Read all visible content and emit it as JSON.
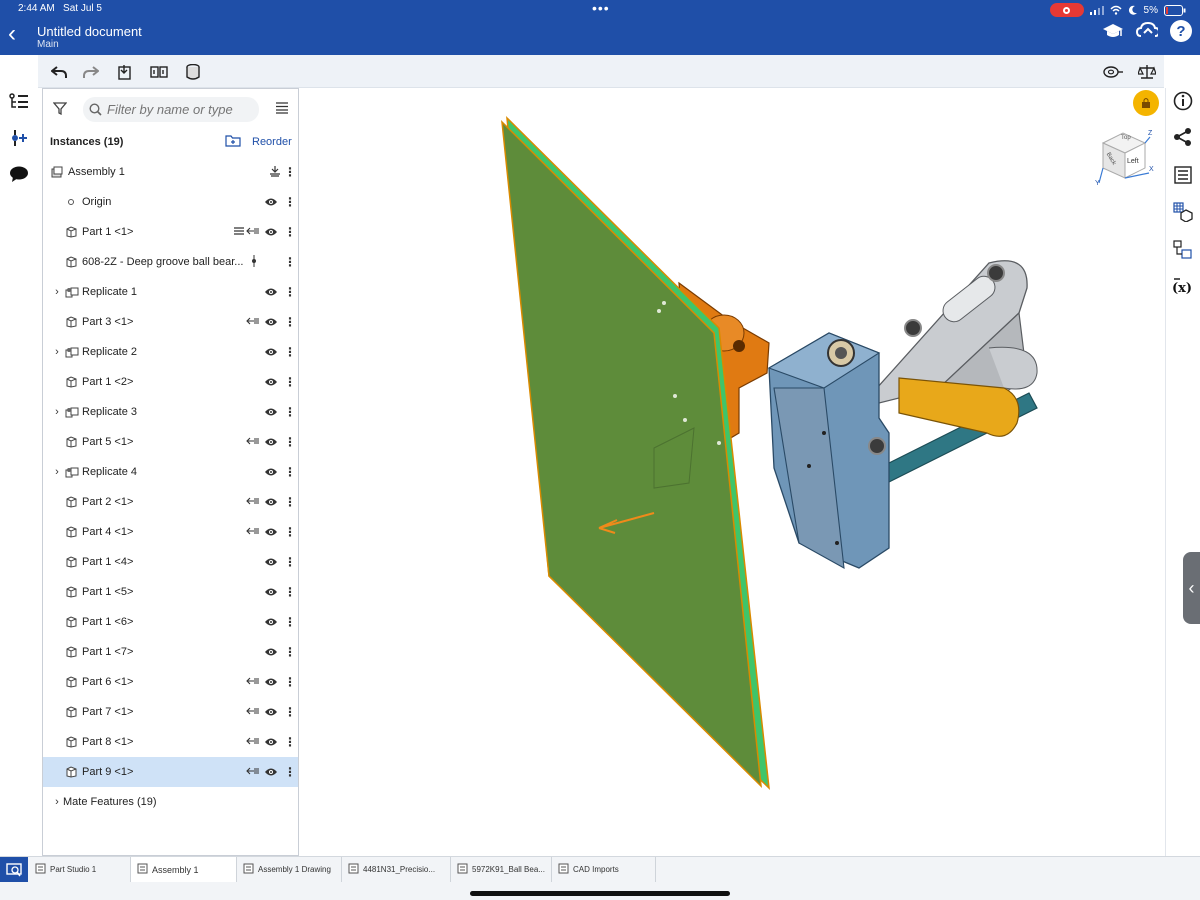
{
  "status_bar": {
    "time": "2:44 AM",
    "date": "Sat Jul 5",
    "battery": "5%"
  },
  "header": {
    "title": "Untitled document",
    "subtitle": "Main"
  },
  "panel": {
    "search_placeholder": "Filter by name or type",
    "instances_label": "Instances (19)",
    "reorder_label": "Reorder",
    "rows": [
      {
        "label": "Assembly 1",
        "type": "assembly",
        "expandable": false,
        "mate": false,
        "eye": false,
        "special": "fix"
      },
      {
        "label": "Origin",
        "type": "origin",
        "expandable": false,
        "mate": false,
        "eye": true
      },
      {
        "label": "Part 1 <1>",
        "type": "part",
        "expandable": false,
        "mate": true,
        "eye": true,
        "special": "fixed"
      },
      {
        "label": "608-2Z - Deep groove ball bear...",
        "type": "part",
        "expandable": false,
        "mate": false,
        "eye": false,
        "special": "pin"
      },
      {
        "label": "Replicate 1",
        "type": "replicate",
        "expandable": true,
        "mate": false,
        "eye": true
      },
      {
        "label": "Part 3 <1>",
        "type": "part",
        "expandable": false,
        "mate": true,
        "eye": true
      },
      {
        "label": "Replicate 2",
        "type": "replicate",
        "expandable": true,
        "mate": false,
        "eye": true
      },
      {
        "label": "Part 1 <2>",
        "type": "part",
        "expandable": false,
        "mate": false,
        "eye": true
      },
      {
        "label": "Replicate 3",
        "type": "replicate",
        "expandable": true,
        "mate": false,
        "eye": true
      },
      {
        "label": "Part 5 <1>",
        "type": "part",
        "expandable": false,
        "mate": true,
        "eye": true
      },
      {
        "label": "Replicate 4",
        "type": "replicate",
        "expandable": true,
        "mate": false,
        "eye": true
      },
      {
        "label": "Part 2 <1>",
        "type": "part",
        "expandable": false,
        "mate": true,
        "eye": true
      },
      {
        "label": "Part 4 <1>",
        "type": "part",
        "expandable": false,
        "mate": true,
        "eye": true
      },
      {
        "label": "Part 1 <4>",
        "type": "part",
        "expandable": false,
        "mate": false,
        "eye": true
      },
      {
        "label": "Part 1 <5>",
        "type": "part",
        "expandable": false,
        "mate": false,
        "eye": true
      },
      {
        "label": "Part 1 <6>",
        "type": "part",
        "expandable": false,
        "mate": false,
        "eye": true
      },
      {
        "label": "Part 1 <7>",
        "type": "part",
        "expandable": false,
        "mate": false,
        "eye": true
      },
      {
        "label": "Part 6 <1>",
        "type": "part",
        "expandable": false,
        "mate": true,
        "eye": true
      },
      {
        "label": "Part 7 <1>",
        "type": "part",
        "expandable": false,
        "mate": true,
        "eye": true
      },
      {
        "label": "Part 8 <1>",
        "type": "part",
        "expandable": false,
        "mate": true,
        "eye": true
      },
      {
        "label": "Part 9 <1>",
        "type": "part",
        "expandable": false,
        "mate": true,
        "eye": true,
        "selected": true
      }
    ],
    "mate_features_label": "Mate Features (19)"
  },
  "viewcube": {
    "face_left": "Left",
    "face_back": "Back",
    "face_top": "Top",
    "axis_x": "X",
    "axis_y": "Y",
    "axis_z": "Z"
  },
  "tabs": [
    {
      "label": "Part Studio 1",
      "active": false
    },
    {
      "label": "Assembly 1",
      "active": true
    },
    {
      "label": "Assembly 1 Drawing",
      "active": false
    },
    {
      "label": "4481N31_Precisio...",
      "active": false
    },
    {
      "label": "5972K91_Ball Bea...",
      "active": false
    },
    {
      "label": "CAD Imports",
      "active": false
    }
  ],
  "colors": {
    "brand": "#1f4fa8",
    "selected_row": "#cfe2f7",
    "plate": "#5e8c3a",
    "plate_edge": "#3fc56a",
    "orange_part": "#e07a12",
    "yellow_part": "#e8a81a",
    "blue_part": "#6f96b8",
    "gray_part": "#c9ccd0",
    "teal_rod": "#2f7784"
  }
}
